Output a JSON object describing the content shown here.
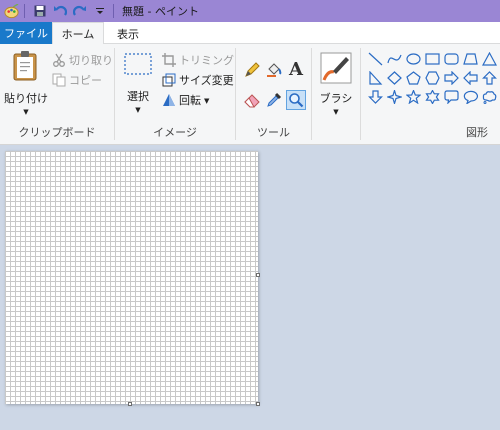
{
  "window": {
    "title": "無題 - ペイント"
  },
  "tabs": {
    "file": "ファイル",
    "home": "ホーム",
    "view": "表示"
  },
  "clipboard": {
    "paste": "貼り付け",
    "cut": "切り取り",
    "copy": "コピー",
    "label": "クリップボード"
  },
  "image": {
    "select": "選択",
    "crop": "トリミング",
    "resize": "サイズ変更",
    "rotate": "回転",
    "label": "イメージ"
  },
  "tools": {
    "label": "ツール",
    "text_glyph": "A"
  },
  "brushes": {
    "label": "ブラシ"
  },
  "shapes": {
    "label": "図形",
    "items": [
      "line-icon",
      "curve-icon",
      "oval-icon",
      "rectangle-icon",
      "rounded-rectangle-icon",
      "polygon-icon",
      "triangle-icon",
      "right-triangle-icon",
      "diamond-icon",
      "pentagon-icon",
      "hexagon-icon",
      "right-arrow-icon",
      "left-arrow-icon",
      "up-arrow-icon",
      "down-arrow-icon",
      "four-point-star-icon",
      "five-point-star-icon",
      "six-point-star-icon",
      "rounded-callout-icon",
      "oval-callout-icon",
      "cloud-callout-icon"
    ]
  },
  "colors": {
    "accent": "#1979ca",
    "titlebar": "#9a86d4",
    "workspace": "#cdd7e6",
    "icon_blue": "#2b6cc4"
  }
}
